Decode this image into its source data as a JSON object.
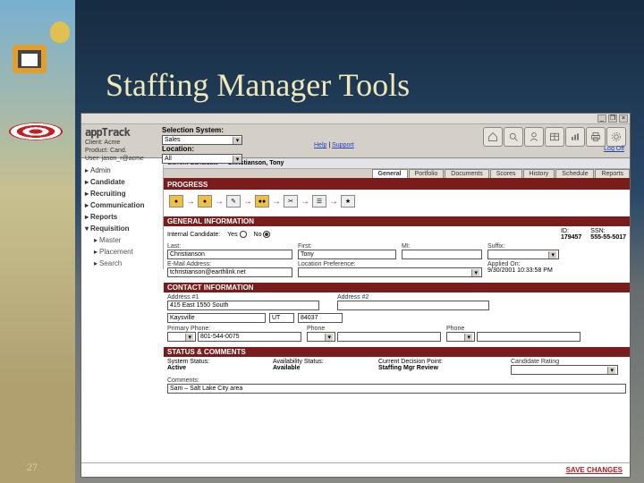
{
  "slide": {
    "title": "Staffing Manager Tools",
    "page_number": "27"
  },
  "window": {
    "controls": {
      "minimize": "_",
      "restore": "❐",
      "close": "×"
    },
    "brand": {
      "logo_text": "appTrack",
      "line1": "Client: Acme",
      "line2": "Product: Cand.",
      "line3": "User: jason_r@acme"
    },
    "selection": {
      "heading": "Selection System:",
      "system_value": "Sales",
      "location_label": "Location:",
      "location_value": "All"
    },
    "links": {
      "help": "Help",
      "support": "Support",
      "logoff": "Log Off"
    },
    "toolbar_icons": [
      "home",
      "search",
      "user",
      "table",
      "chart",
      "print",
      "gear"
    ]
  },
  "nav": {
    "items": [
      {
        "label": "Admin",
        "type": "hdr"
      },
      {
        "label": "Candidate",
        "type": "hdr-bold"
      },
      {
        "label": "Recruiting",
        "type": "hdr-bold"
      },
      {
        "label": "Communication",
        "type": "hdr-bold"
      },
      {
        "label": "Reports",
        "type": "hdr-bold"
      },
      {
        "label": "Requisition",
        "type": "hdr-bold"
      },
      {
        "label": "Master",
        "type": "sub"
      },
      {
        "label": "Placement",
        "type": "sub"
      },
      {
        "label": "Search",
        "type": "sub"
      }
    ]
  },
  "breadcrumb": {
    "a": "Current Candidate",
    "sep": "›",
    "b": "Christianson, Tony"
  },
  "tabs": [
    "General",
    "Portfolio",
    "Documents",
    "Scores",
    "History",
    "Schedule",
    "Reports"
  ],
  "active_tab": "General",
  "sections": {
    "progress_title": "PROGRESS",
    "general_title": "GENERAL INFORMATION",
    "contact_title": "CONTACT INFORMATION",
    "status_title": "STATUS & COMMENTS"
  },
  "general": {
    "internal_label": "Internal Candidate:",
    "yes": "Yes",
    "no": "No",
    "id_label": "ID:",
    "id_value": "179457",
    "ssn_label": "SSN:",
    "ssn_value": "555-55-5017",
    "last_label": "Last:",
    "last_value": "Christianson",
    "first_label": "First:",
    "first_value": "Tony",
    "mi_label": "MI:",
    "mi_value": "",
    "suffix_label": "Suffix:",
    "suffix_value": "",
    "email_label": "E-Mail Address:",
    "email_value": "tchristianson@earthlink.net",
    "locpref_label": "Location Preference:",
    "locpref_value": "",
    "applied_label": "Applied On:",
    "applied_value": "9/30/2001 10:33:58 PM"
  },
  "contact": {
    "addr1_label": "Address #1",
    "addr1_value": "415 East 1550 South",
    "addr2_label": "Address #2",
    "addr2_value": "",
    "city_label": "",
    "city_value": "Kaysville",
    "state_value": "UT",
    "zip_label": "",
    "zip_value": "84037",
    "pphone_label": "Primary Phone:",
    "pphone_value": "801-544-0075",
    "phone2_label": "Phone",
    "phone2_value": "",
    "phone3_label": "Phone",
    "phone3_value": ""
  },
  "status": {
    "sys_status_label": "System Status:",
    "sys_status_value": "Active",
    "avail_label": "Availability Status:",
    "avail_value": "Available",
    "decision_label": "Current Decision Point:",
    "decision_value": "Staffing Mgr Review",
    "rating_label": "Candidate Rating",
    "rating_value": "",
    "comments_label": "Comments:",
    "comments_value": "Sam – Salt Lake City area"
  },
  "save_label": "SAVE CHANGES"
}
